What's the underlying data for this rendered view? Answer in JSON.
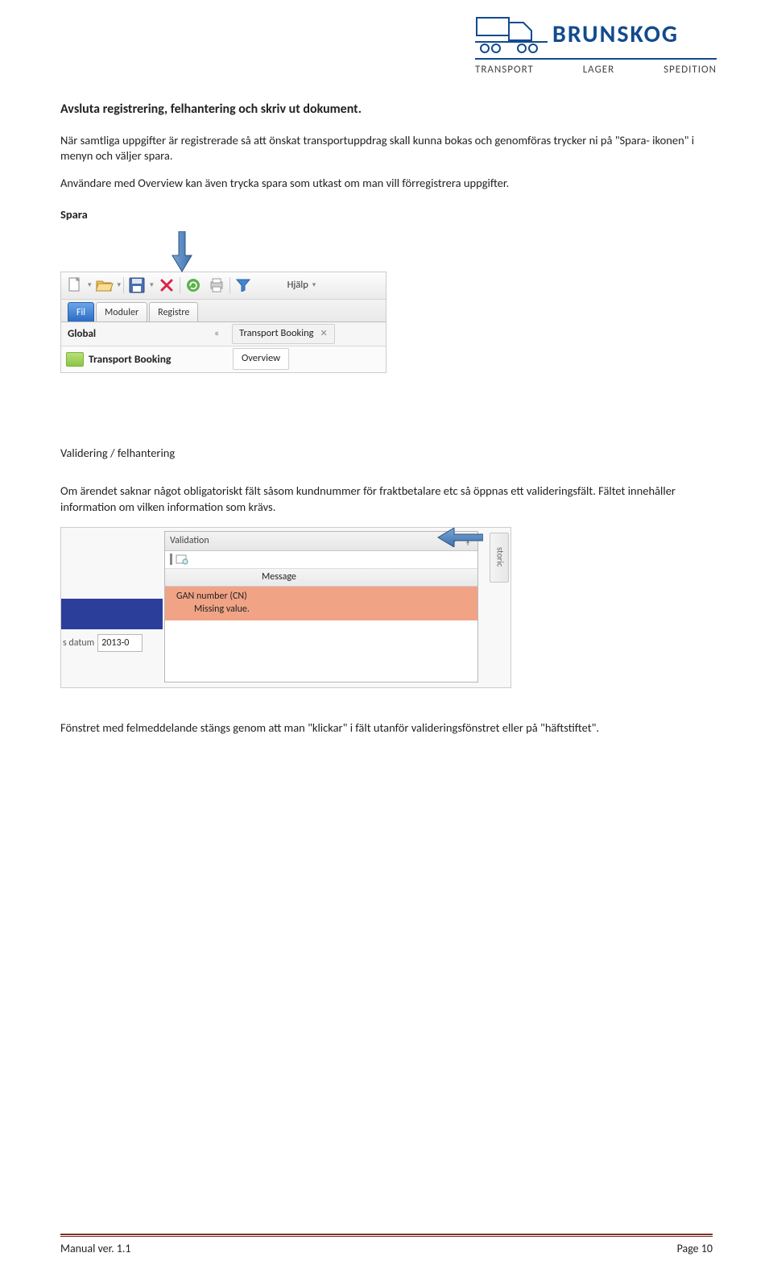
{
  "logo": {
    "brand": "BRUNSKOG",
    "sub1": "TRANSPORT",
    "sub2": "LAGER",
    "sub3": "SPEDITION"
  },
  "heading": "Avsluta registrering, felhantering och skriv ut dokument.",
  "para1": "När samtliga uppgifter är registrerade så att önskat transportuppdrag skall kunna bokas och genomföras trycker ni på \"Spara- ikonen\" i menyn och väljer spara.",
  "para2": "Användare med Overview kan även trycka spara som utkast om man vill förregistrera uppgifter.",
  "spara_label": "Spara",
  "ui1": {
    "help_menu": "Hjälp",
    "tab_fil": "Fil",
    "tab_moduler": "Moduler",
    "tab_registre": "Registre",
    "global": "Global",
    "transport_booking_tab": "Transport Booking",
    "transport_booking_nav": "Transport Booking",
    "overview_chip": "Overview"
  },
  "validering_heading": "Validering / felhantering",
  "para3": "Om ärendet saknar något obligatoriskt fält såsom kundnummer för fraktbetalare etc så öppnas ett valideringsfält. Fältet innehåller information om vilken information som krävs.",
  "ui2": {
    "panel_title": "Validation",
    "msg_header": "Message",
    "err_line1": "GAN number (CN)",
    "err_line2": "Missing value.",
    "date_label": "s datum",
    "date_value": "2013-0",
    "side_tab": "storic"
  },
  "para4": "Fönstret med felmeddelande stängs genom att man \"klickar\" i fält utanför valideringsfönstret eller på \"häftstiftet\".",
  "footer": {
    "version": "Manual ver. 1.1",
    "page": "Page 10"
  }
}
